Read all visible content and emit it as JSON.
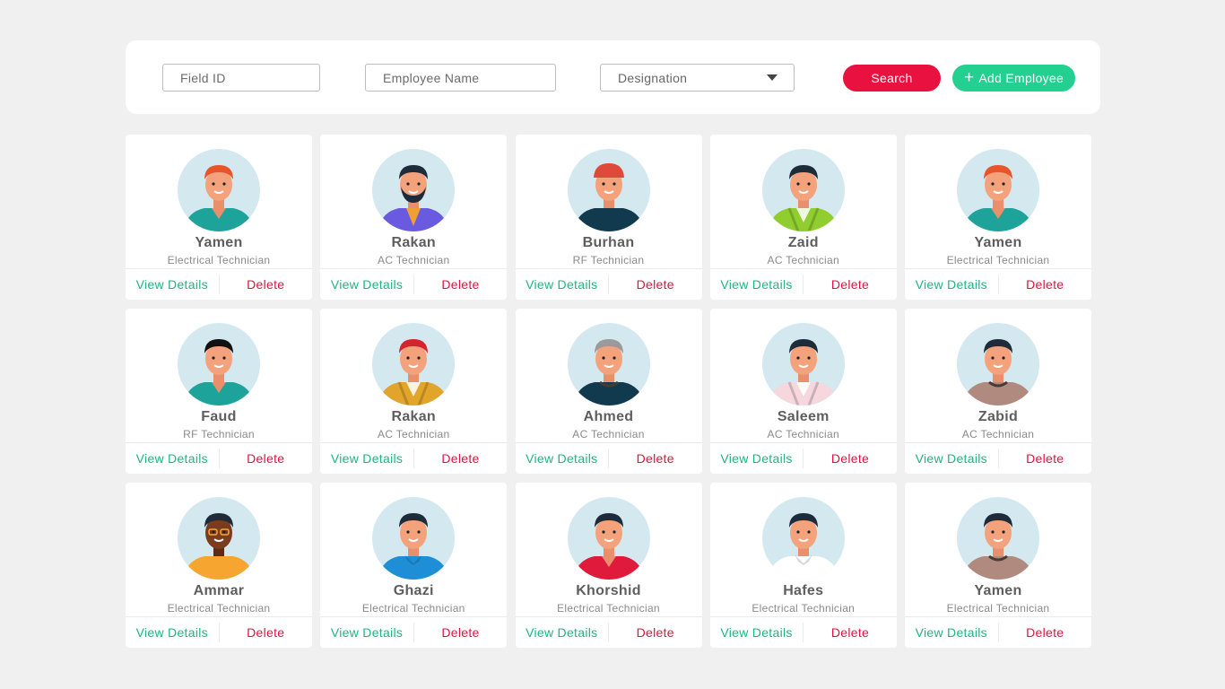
{
  "filters": {
    "field_id_placeholder": "Field ID",
    "employee_name_placeholder": "Employee Name",
    "designation_label": "Designation",
    "search_label": "Search",
    "add_employee_label": "Add Employee"
  },
  "card_actions": {
    "view_label": "View Details",
    "delete_label": "Delete"
  },
  "colors": {
    "accent_red": "#e8113f",
    "accent_green": "#23d08f",
    "avatar_bg": "#d3e8ef"
  },
  "employees": [
    {
      "name": "Yamen",
      "role": "Electrical Technician",
      "hair": "#e8552b",
      "shirt": "#1da39a",
      "style": "vneck"
    },
    {
      "name": "Rakan",
      "role": "AC Technician",
      "hair": "#1d2b3a",
      "shirt": "#6a5ae0",
      "style": "beard"
    },
    {
      "name": "Burhan",
      "role": "RF Technician",
      "hair": "#e04a3a",
      "shirt": "#123a4e",
      "style": "cap"
    },
    {
      "name": "Zaid",
      "role": "AC Technician",
      "hair": "#1d2b3a",
      "shirt": "#8fce2e",
      "style": "jacket"
    },
    {
      "name": "Yamen",
      "role": "Electrical Technician",
      "hair": "#e8552b",
      "shirt": "#1da39a",
      "style": "vneck"
    },
    {
      "name": "Faud",
      "role": "RF Technician",
      "hair": "#111111",
      "shirt": "#1da39a",
      "style": "vneck"
    },
    {
      "name": "Rakan",
      "role": "AC Technician",
      "hair": "#d4242f",
      "shirt": "#e2a52b",
      "style": "jacket"
    },
    {
      "name": "Ahmed",
      "role": "AC Technician",
      "hair": "#9a9a9a",
      "shirt": "#123a4e",
      "style": "crew"
    },
    {
      "name": "Saleem",
      "role": "AC Technician",
      "hair": "#1d2b3a",
      "shirt": "#f7d7de",
      "style": "jacket"
    },
    {
      "name": "Zabid",
      "role": "AC Technician",
      "hair": "#1d2b3a",
      "shirt": "#b08a7e",
      "style": "crew"
    },
    {
      "name": "Ammar",
      "role": "Electrical Technician",
      "hair": "#1d2b3a",
      "shirt": "#f7a531",
      "style": "dark"
    },
    {
      "name": "Ghazi",
      "role": "Electrical Technician",
      "hair": "#1d2b3a",
      "shirt": "#1e8fd6",
      "style": "collar"
    },
    {
      "name": "Khorshid",
      "role": "Electrical Technician",
      "hair": "#1d2b3a",
      "shirt": "#e01a3b",
      "style": "vneck"
    },
    {
      "name": "Hafes",
      "role": "Electrical Technician",
      "hair": "#1d2b3a",
      "shirt": "#ffffff",
      "style": "collar"
    },
    {
      "name": "Yamen",
      "role": "Electrical Technician",
      "hair": "#1d2b3a",
      "shirt": "#b08a7e",
      "style": "crew"
    }
  ]
}
